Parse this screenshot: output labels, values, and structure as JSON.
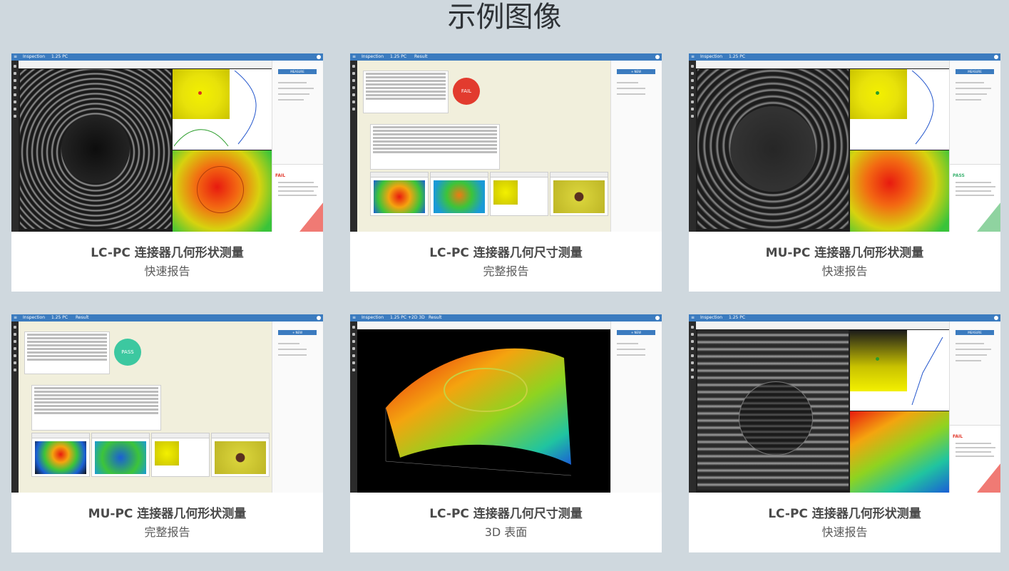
{
  "page": {
    "title": "示例图像"
  },
  "cards": [
    {
      "title": "LC-PC 连接器几何形状测量",
      "subtitle": "快速报告",
      "tab1": "Inspection",
      "tab2": "1.25 PC",
      "tab3": "",
      "status": "FAIL",
      "status_color": "#e23b2e"
    },
    {
      "title": "LC-PC 连接器几何尺寸测量",
      "subtitle": "完整报告",
      "tab1": "Inspection",
      "tab2": "1.25 PC",
      "tab3": "Result",
      "status": "FAIL",
      "status_color": "#e23b2e"
    },
    {
      "title": "MU-PC 连接器几何形状测量",
      "subtitle": "快速报告",
      "tab1": "Inspection",
      "tab2": "1.25 PC",
      "tab3": "",
      "status": "PASS",
      "status_color": "#3cb371"
    },
    {
      "title": "MU-PC 连接器几何形状测量",
      "subtitle": "完整报告",
      "tab1": "Inspection",
      "tab2": "1.25 PC",
      "tab3": "Result",
      "status": "PASS",
      "status_color": "#3cc8a0"
    },
    {
      "title": "LC-PC 连接器几何尺寸测量",
      "subtitle": "3D 表面",
      "tab1": "Inspection",
      "tab2": "1.25 PC +2D 3D",
      "tab3": "Result",
      "status": "",
      "status_color": ""
    },
    {
      "title": "LC-PC 连接器几何形状测量",
      "subtitle": "快速报告",
      "tab1": "Inspection",
      "tab2": "1.25 PC",
      "tab3": "",
      "status": "FAIL",
      "status_color": "#e23b2e"
    }
  ]
}
